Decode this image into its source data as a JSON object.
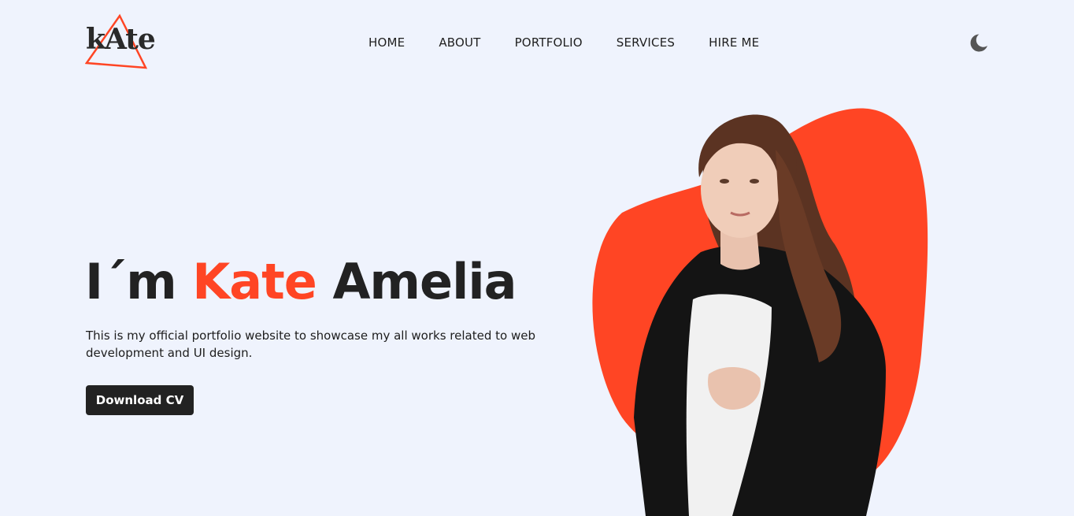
{
  "brand": {
    "logo_text": "kAte",
    "accent_color": "#ff4524",
    "text_color": "#222222",
    "background": "#eff3fd"
  },
  "nav": {
    "items": [
      {
        "label": "HOME"
      },
      {
        "label": "ABOUT"
      },
      {
        "label": "PORTFOLIO"
      },
      {
        "label": "SERVICES"
      },
      {
        "label": "HIRE ME"
      }
    ]
  },
  "header": {
    "theme_toggle_icon": "moon-icon"
  },
  "hero": {
    "greeting": "I´m",
    "first_name": "Kate",
    "last_name": "Amelia",
    "description": "This is my official portfolio website to showcase my all works related to web development and UI design.",
    "cta_label": "Download CV"
  }
}
